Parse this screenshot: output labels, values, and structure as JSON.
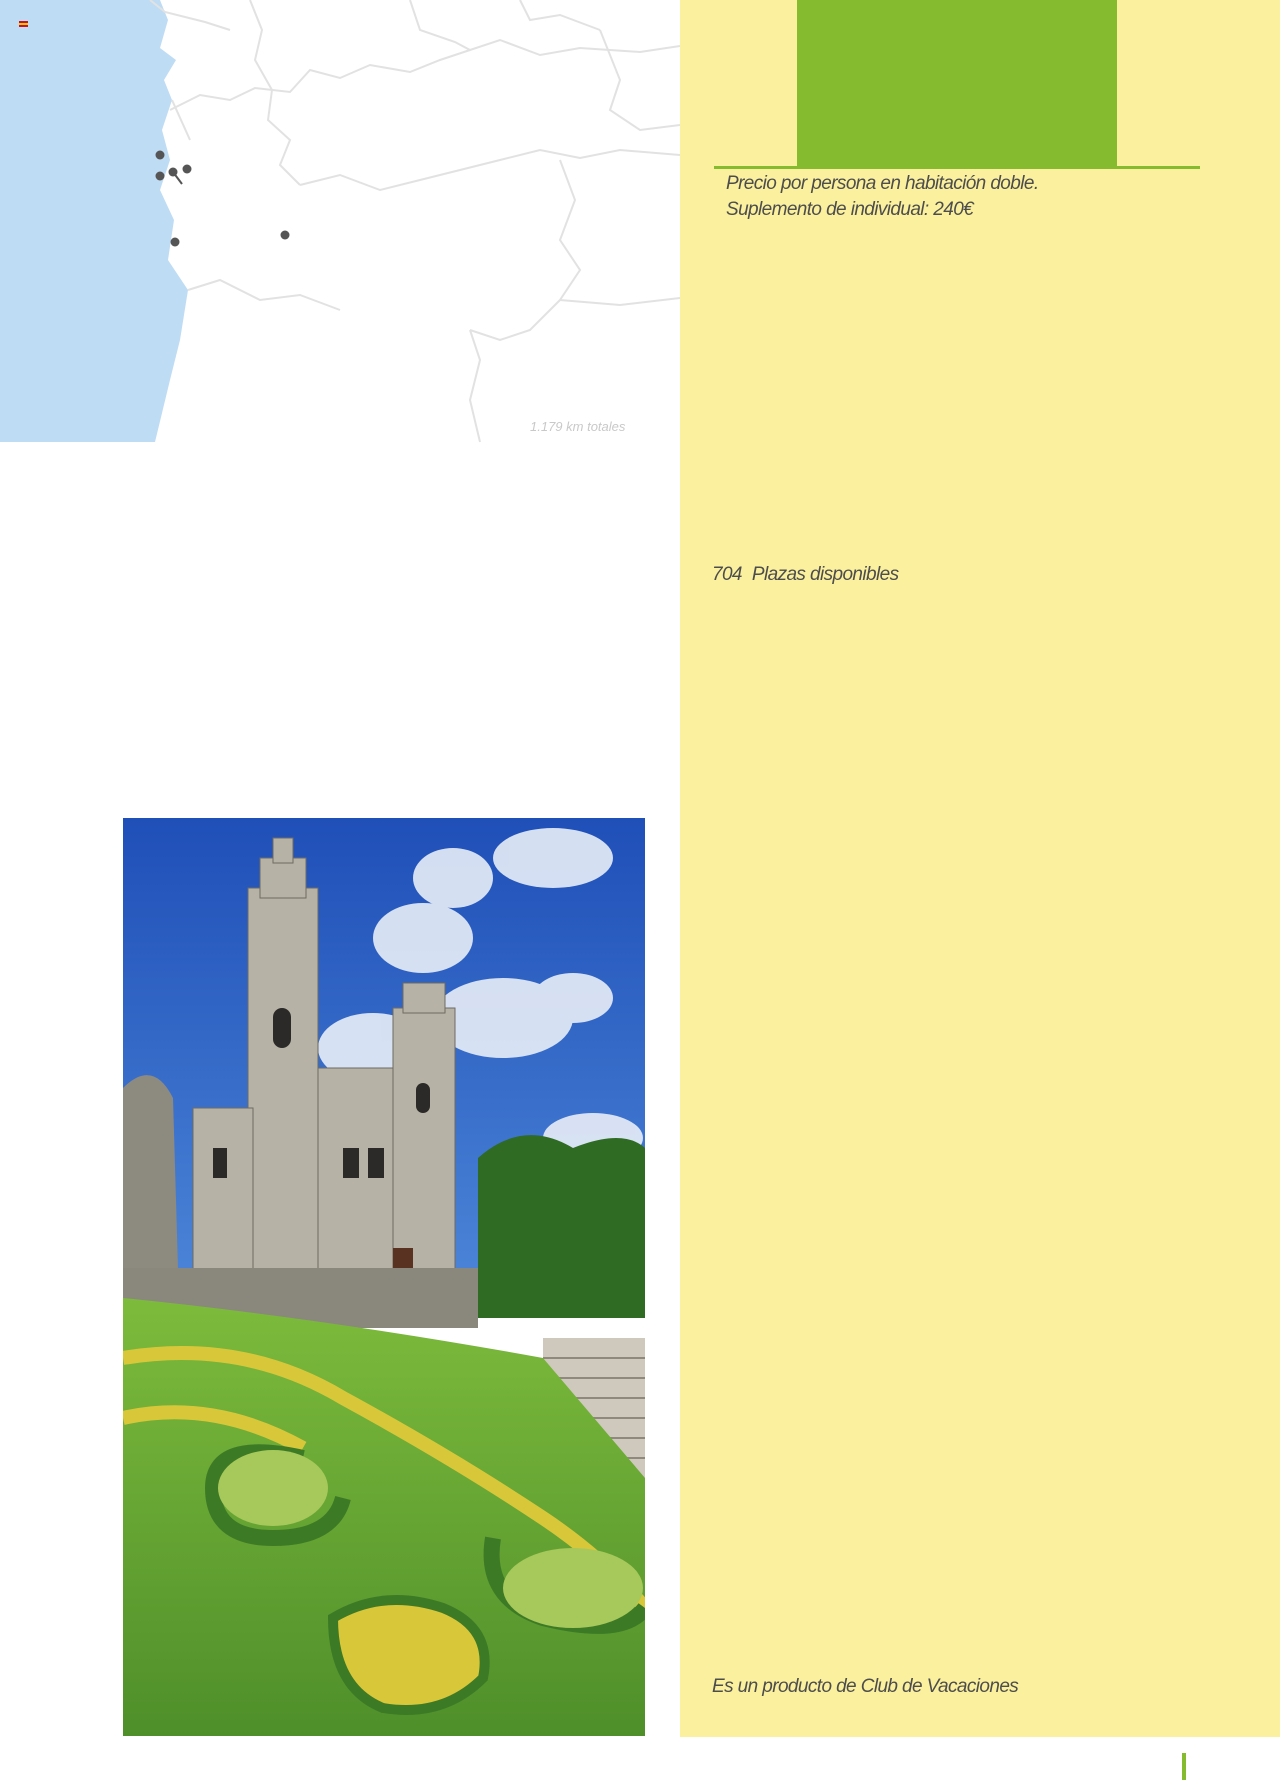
{
  "map": {
    "distance_label": "1.179 km totales",
    "colors": {
      "sea": "#bfdcf5",
      "land": "#ffffff",
      "border": "#e2e2e2",
      "marker": "#555555"
    }
  },
  "sidebar": {
    "price_line": "Precio por persona en habitación doble.",
    "supplement_line": "Suplemento de individual: 240€",
    "seats_count": "704",
    "seats_label": "Plazas disponibles",
    "product_line": "Es un producto de Club de Vacaciones",
    "colors": {
      "panel": "#fbf09d",
      "accent": "#85bb2f",
      "text": "#4d4d4d"
    }
  },
  "photo": {
    "colors": {
      "sky": "#2a5fc4",
      "stone": "#a8a49a",
      "lawn": "#6aa834",
      "hedge": "#d9c73a"
    }
  }
}
